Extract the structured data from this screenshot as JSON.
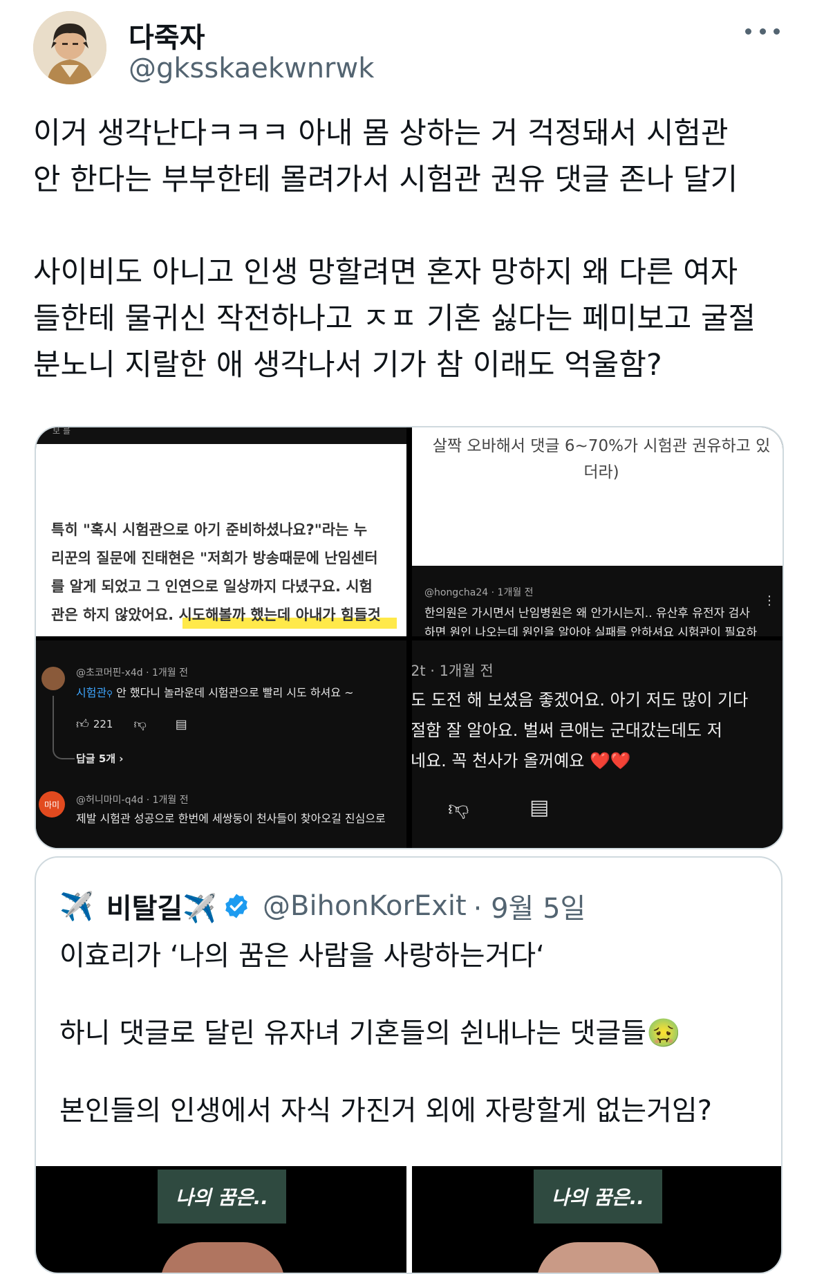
{
  "author": {
    "display_name": "다죽자",
    "handle": "@gksskaekwnrwk"
  },
  "tweet_text": "이거 생각난다ㅋㅋㅋ 아내 몸 상하는 거 걱정돼서 시험관\n안 한다는 부부한테 몰려가서 시험관 권유 댓글 존나 달기\n\n사이비도 아니고 인생 망할려면 혼자 망하지 왜 다른 여자\n들한테 물귀신 작전하나고 ㅈㅍ 기혼 싫다는 페미보고 굴절\n분노니 지랄한 애 생각나서 기가 참 이래도 억울함?",
  "media": {
    "article": {
      "header_fragment": "보 를",
      "text_lines": [
        "특히 \"혹시 시험관으로 아기 준비하셨나요?\"라는 누",
        "리꾼의 질문에 진태현은 \"저희가 방송때문에 난임센터",
        "를 알게 되었고 그 인연으로 일상까지 다녔구요. 시험",
        "관은 하지 않았어요. 시도해볼까 했는데 아내가 힘들것"
      ]
    },
    "caption_fragment": {
      "line1": "살짝 오바해서 댓글 6~70%가 시험관 권유하고 있",
      "line2": "더라)"
    },
    "yt_comment_top": {
      "user": "@hongcha24",
      "time": "1개월 전",
      "line1": "한의원은 가시면서 난임병원은 왜 안가시는지.. 유산후 유전자 검사",
      "line2": "하면 원인 나오는데 원인을 알아야 실패를 안하셔요 시험관이 필요하"
    },
    "yt_comment_left": {
      "user": "@초코머핀-x4d",
      "time": "1개월 전",
      "tag": "시험관",
      "text": "안 했다니 놀라운데 시험관으로 빨리 시도 하셔요 ~",
      "likes": "221",
      "replies": "답글 5개",
      "user2": "@허니마미-q4d",
      "time2": "1개월 전",
      "avatar2_text": "마미",
      "text2": "제발 시험관 성공으로 한번에 세쌍둥이 천사들이 찾아오길 진심으로"
    },
    "yt_comment_right": {
      "user_fragment": "2t",
      "time": "1개월 전",
      "line1": "도 도전 해 보셨음 좋겠어요. 아기 저도 많이 기다",
      "line2": "절함 잘 알아요. 벌써 큰애는 군대갔는데도 저",
      "line3": "네요. 꼭 천사가 올꺼예요",
      "hearts": "❤️❤️"
    }
  },
  "quote": {
    "display_name": "비탈길✈️",
    "handle": "@BihonKorExit",
    "date": "· 9월 5일",
    "airplane_emoji": "✈️",
    "text": "이효리가 ‘나의 꿈은 사람을 사랑하는거다‘\n\n하니 댓글로 달린 유자녀 기혼들의 쉰내나는 댓글들🤢\n\n본인들의 인생에서 자식 가진거 외에 자랑할게 없는거임?",
    "img_label": "나의 꿈은..",
    "img_label2": "나의 꿈은.."
  },
  "colors": {
    "verified": "#1d9bf0",
    "secondary_text": "#536471",
    "border": "#cfd9de",
    "highlight": "#ffe94a"
  }
}
